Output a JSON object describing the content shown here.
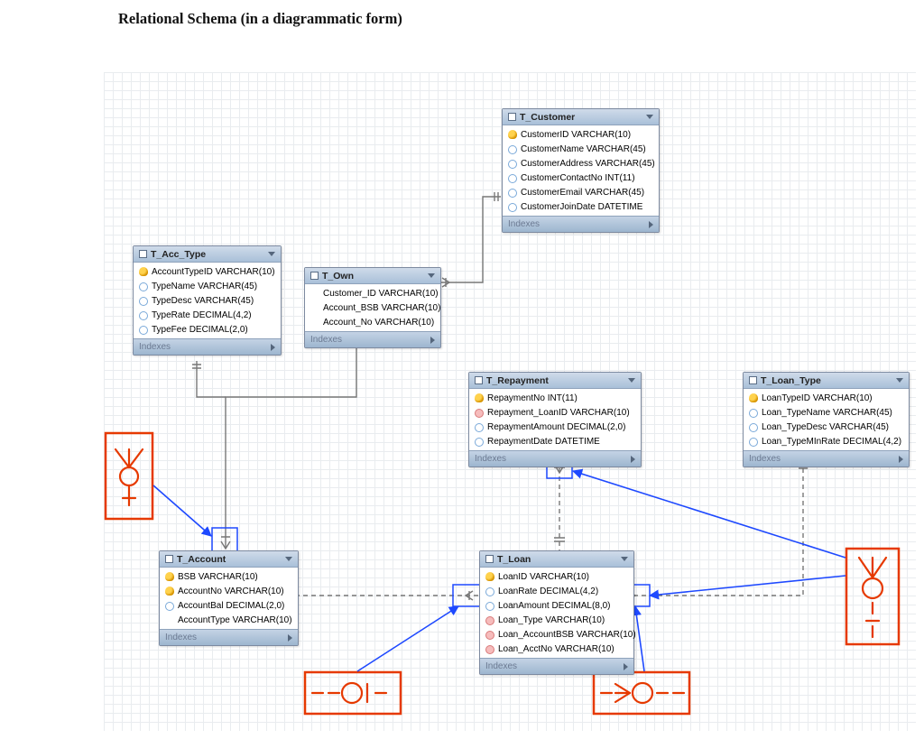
{
  "title": "Relational Schema (in a diagrammatic form)",
  "footer_label": "Indexes",
  "entities": {
    "t_customer": {
      "name": "T_Customer",
      "cols": [
        {
          "ic": "key",
          "txt": "CustomerID VARCHAR(10)"
        },
        {
          "ic": "col",
          "txt": "CustomerName VARCHAR(45)"
        },
        {
          "ic": "col",
          "txt": "CustomerAddress VARCHAR(45)"
        },
        {
          "ic": "col",
          "txt": "CustomerContactNo INT(11)"
        },
        {
          "ic": "col",
          "txt": "CustomerEmail VARCHAR(45)"
        },
        {
          "ic": "col",
          "txt": "CustomerJoinDate DATETIME"
        }
      ]
    },
    "t_acc_type": {
      "name": "T_Acc_Type",
      "cols": [
        {
          "ic": "key",
          "txt": "AccountTypeID VARCHAR(10)"
        },
        {
          "ic": "col",
          "txt": "TypeName VARCHAR(45)"
        },
        {
          "ic": "col",
          "txt": "TypeDesc VARCHAR(45)"
        },
        {
          "ic": "col",
          "txt": "TypeRate DECIMAL(4,2)"
        },
        {
          "ic": "col",
          "txt": "TypeFee DECIMAL(2,0)"
        }
      ]
    },
    "t_own": {
      "name": "T_Own",
      "cols": [
        {
          "ic": "none",
          "txt": "Customer_ID VARCHAR(10)"
        },
        {
          "ic": "none",
          "txt": "Account_BSB VARCHAR(10)"
        },
        {
          "ic": "none",
          "txt": "Account_No VARCHAR(10)"
        }
      ]
    },
    "t_repayment": {
      "name": "T_Repayment",
      "cols": [
        {
          "ic": "key",
          "txt": "RepaymentNo INT(11)"
        },
        {
          "ic": "fk",
          "txt": "Repayment_LoanID VARCHAR(10)"
        },
        {
          "ic": "col",
          "txt": "RepaymentAmount DECIMAL(2,0)"
        },
        {
          "ic": "col",
          "txt": "RepaymentDate DATETIME"
        }
      ]
    },
    "t_loan_type": {
      "name": "T_Loan_Type",
      "cols": [
        {
          "ic": "key",
          "txt": "LoanTypeID VARCHAR(10)"
        },
        {
          "ic": "col",
          "txt": "Loan_TypeName VARCHAR(45)"
        },
        {
          "ic": "col",
          "txt": "Loan_TypeDesc VARCHAR(45)"
        },
        {
          "ic": "col",
          "txt": "Loan_TypeMInRate DECIMAL(4,2)"
        }
      ]
    },
    "t_account": {
      "name": "T_Account",
      "cols": [
        {
          "ic": "key",
          "txt": "BSB VARCHAR(10)"
        },
        {
          "ic": "key",
          "txt": "AccountNo VARCHAR(10)"
        },
        {
          "ic": "col",
          "txt": "AccountBal DECIMAL(2,0)"
        },
        {
          "ic": "none",
          "txt": "AccountType VARCHAR(10)"
        }
      ]
    },
    "t_loan": {
      "name": "T_Loan",
      "cols": [
        {
          "ic": "key",
          "txt": "LoanID VARCHAR(10)"
        },
        {
          "ic": "col",
          "txt": "LoanRate DECIMAL(4,2)"
        },
        {
          "ic": "col",
          "txt": "LoanAmount DECIMAL(8,0)"
        },
        {
          "ic": "fk",
          "txt": "Loan_Type VARCHAR(10)"
        },
        {
          "ic": "fk",
          "txt": "Loan_AccountBSB VARCHAR(10)"
        },
        {
          "ic": "fk",
          "txt": "Loan_AcctNo VARCHAR(10)"
        }
      ]
    }
  }
}
